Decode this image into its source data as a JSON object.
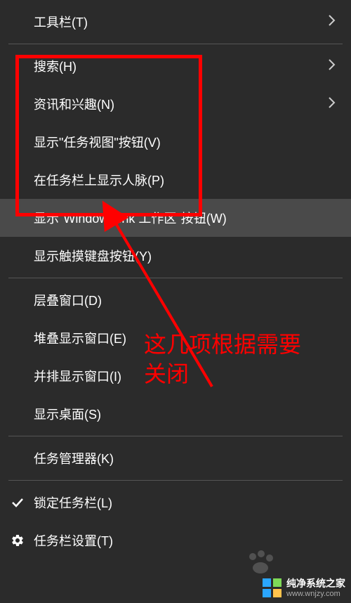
{
  "menu": {
    "toolbars": "工具栏(T)",
    "search": "搜索(H)",
    "news": "资讯和兴趣(N)",
    "taskview": "显示\"任务视图\"按钮(V)",
    "people": "在任务栏上显示人脉(P)",
    "ink": "显示\"Windows Ink 工作区\"按钮(W)",
    "touchkb": "显示触摸键盘按钮(Y)",
    "cascade": "层叠窗口(D)",
    "stacked": "堆叠显示窗口(E)",
    "sidebyside": "并排显示窗口(I)",
    "desktop": "显示桌面(S)",
    "taskmgr": "任务管理器(K)",
    "lock": "锁定任务栏(L)",
    "settings": "任务栏设置(T)"
  },
  "annotation": {
    "text_line1": "这几项根据需要",
    "text_line2": "关闭"
  },
  "watermark": {
    "title": "纯净系统之家",
    "url": "www.wnjzy.com"
  }
}
